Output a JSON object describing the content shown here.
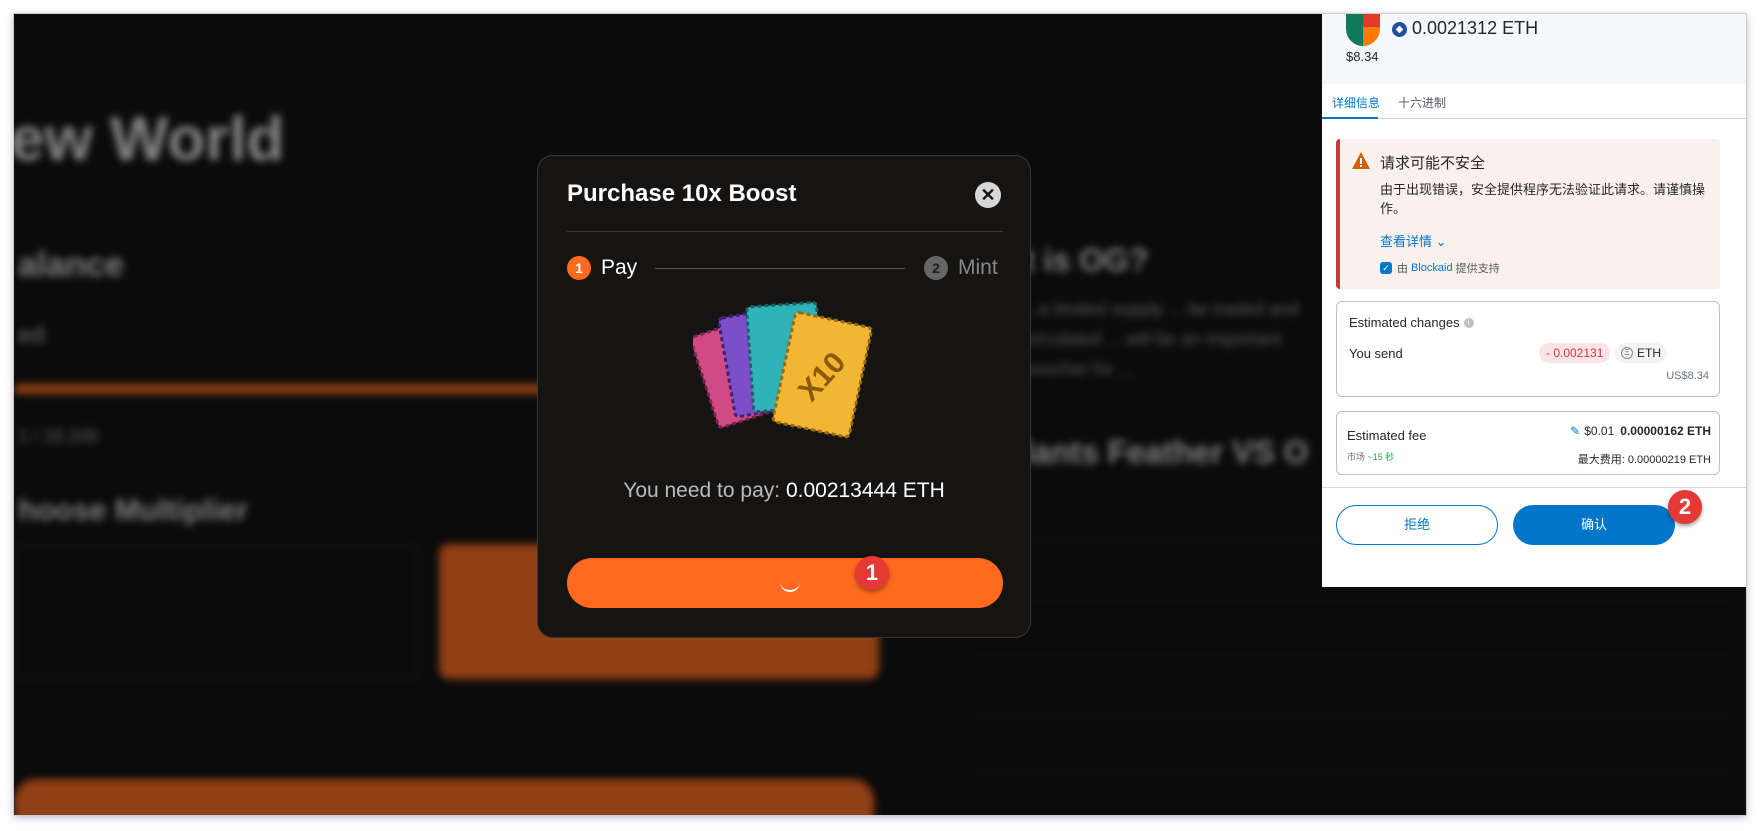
{
  "background": {
    "title": "ew World",
    "section_balance": "alance",
    "sub": "ed",
    "stat": "1 / 10,100",
    "choose": "hoose Multiplier",
    "right_title": "t is OG?",
    "right_text": "...a limited supply ... be traded and circulated ... will be an important voucher for ...",
    "right_compare": "lants Feather VS O"
  },
  "modal": {
    "title": "Purchase 10x Boost",
    "close_icon": "close-icon",
    "steps": [
      {
        "number": "1",
        "label": "Pay"
      },
      {
        "number": "2",
        "label": "Mint"
      }
    ],
    "pay_prefix": "You need to pay:",
    "pay_amount": "0.00213444 ETH",
    "art_label": "X10"
  },
  "annotations": {
    "badge1": "1",
    "badge2": "2"
  },
  "wallet": {
    "amount": "0.0021312 ETH",
    "usd": "$8.34",
    "tabs": [
      "详细信息",
      "十六进制"
    ],
    "alert": {
      "title": "请求可能不安全",
      "body": "由于出现错误，安全提供程序无法验证此请求。请谨慎操作。",
      "link": "查看详情",
      "footer_pre": "由",
      "footer_brand": "Blockaid",
      "footer_post": "提供支持"
    },
    "changes": {
      "title": "Estimated changes",
      "send_label": "You send",
      "send_value": "- 0.002131",
      "token": "ETH",
      "send_usd": "US$8.34"
    },
    "fee": {
      "label": "Estimated fee",
      "market": "市场",
      "market_time": "~15 秒",
      "fiat": "$0.01",
      "eth": "0.00000162 ETH",
      "max_label": "最大费用:",
      "max_value": "0.00000219 ETH"
    },
    "reject": "拒绝",
    "confirm": "确认"
  },
  "colors": {
    "accent": "#ff6a1e",
    "metamask_blue": "#0376c9",
    "danger": "#d73847"
  }
}
